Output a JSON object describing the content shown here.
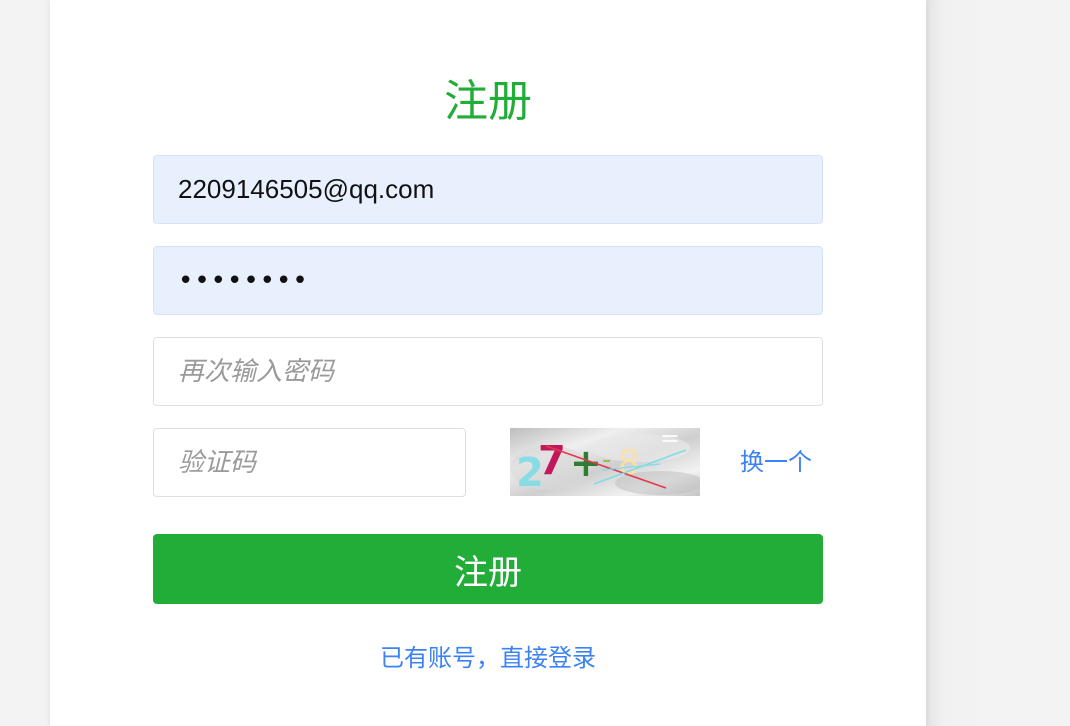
{
  "form": {
    "title": "注册",
    "email_value": "2209146505@qq.com",
    "password_masked": "••••••••",
    "confirm_password_placeholder": "再次输入密码",
    "captcha_placeholder": "验证码",
    "captcha_text": "27+-8=",
    "refresh_captcha_label": "换一个",
    "submit_label": "注册",
    "login_link_label": "已有账号，直接登录"
  },
  "colors": {
    "accent_green": "#22ac38",
    "link_blue": "#3b82f6",
    "autofill_bg": "#e8f0fe"
  }
}
